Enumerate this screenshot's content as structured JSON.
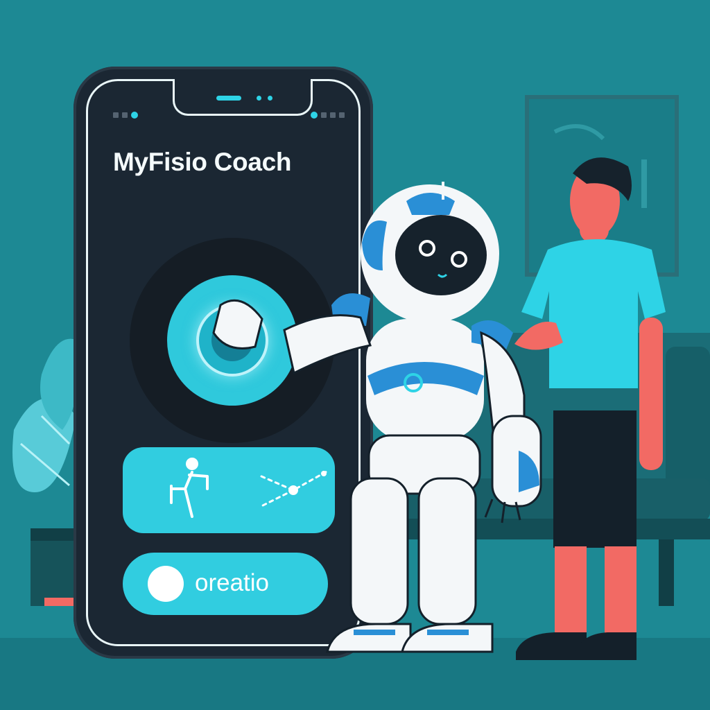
{
  "app": {
    "title": "MyFisio Coach",
    "status_button_label": "oreatio"
  },
  "icons": {
    "exercise": "exercise-figure-icon",
    "progress": "progress-path-icon",
    "status": "status-dot-icon"
  },
  "colors": {
    "background": "#1d8994",
    "phone_body": "#1b2733",
    "accent_cyan": "#31cde0",
    "robot_blue": "#2a8fd6",
    "person_skin": "#f26a64",
    "person_shirt": "#2ed3e6"
  }
}
